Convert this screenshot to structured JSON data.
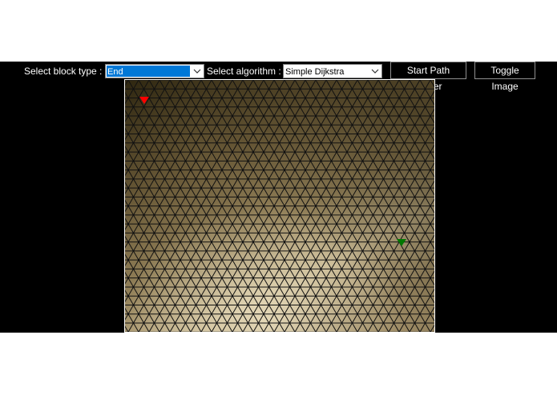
{
  "toolbar": {
    "block_type_label": "Select block type :",
    "block_type_value": "End",
    "algorithm_label": "Select algorithm :",
    "algorithm_value": "Simple Dijkstra",
    "start_button": "Start Path Finder",
    "toggle_button": "Toggle Image"
  },
  "grid": {
    "start_marker_color": "#ff0000",
    "end_marker_color": "#007700"
  },
  "colors": {
    "app_background": "#000000",
    "page_background": "#ffffff",
    "select_highlight": "#0078d7"
  }
}
